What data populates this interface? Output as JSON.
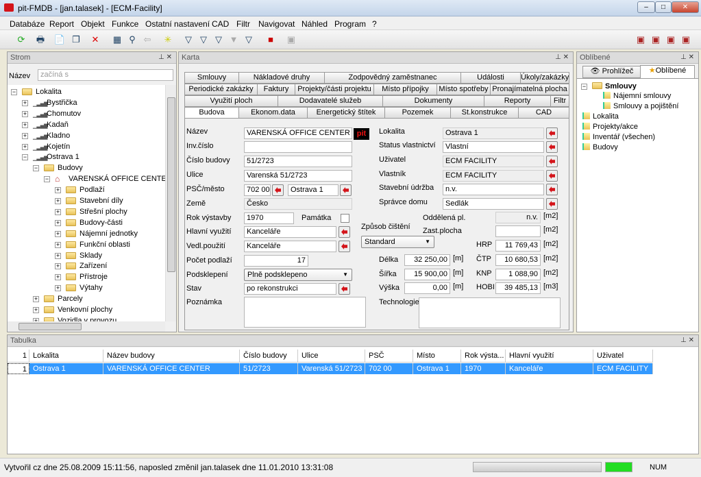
{
  "window": {
    "title": "pit-FMDB - [jan.talasek] - [ECM-Facility]",
    "minimize": "–",
    "maximize": "□",
    "close": "✕"
  },
  "menu": [
    "Databáze",
    "Report",
    "Objekt",
    "Funkce",
    "Ostatní nastavení",
    "CAD",
    "Filtr",
    "Navigovat",
    "Náhled",
    "Program",
    "?"
  ],
  "toolbar": [
    "refresh-icon",
    "print-icon",
    "new-icon",
    "copy-icon",
    "delete-icon",
    "tree-icon",
    "binoculars-icon",
    "back-arrow-icon",
    "sparkle-icon",
    "filter-lightning-icon",
    "filter-table-icon",
    "filter-icon",
    "filter-clear-icon",
    "filter-edit-icon",
    "pit-logo-icon",
    "save-icon"
  ],
  "toolbar_right": [
    "report-icon",
    "car-icon",
    "document-icon",
    "user-icon"
  ],
  "strom": {
    "title": "Strom",
    "search_label": "Název",
    "search_placeholder": "začíná s",
    "items": [
      {
        "label": "Lokalita",
        "level": 0,
        "icon": "folder",
        "exp": "−"
      },
      {
        "label": "Bystřička",
        "level": 1,
        "icon": "bars",
        "exp": "+"
      },
      {
        "label": "Chomutov",
        "level": 1,
        "icon": "bars",
        "exp": "+"
      },
      {
        "label": "Kadaň",
        "level": 1,
        "icon": "bars",
        "exp": "+"
      },
      {
        "label": "Kladno",
        "level": 1,
        "icon": "bars",
        "exp": "+"
      },
      {
        "label": "Kojetín",
        "level": 1,
        "icon": "bars",
        "exp": "+"
      },
      {
        "label": "Ostrava 1",
        "level": 1,
        "icon": "bars",
        "exp": "−"
      },
      {
        "label": "Budovy",
        "level": 2,
        "icon": "folder",
        "exp": "−"
      },
      {
        "label": "VARENSKÁ OFFICE CENTER",
        "level": 3,
        "icon": "house",
        "exp": "−"
      },
      {
        "label": "Podlaží",
        "level": 4,
        "icon": "folder",
        "exp": "+"
      },
      {
        "label": "Stavební díly",
        "level": 4,
        "icon": "folder",
        "exp": "+"
      },
      {
        "label": "Střešní plochy",
        "level": 4,
        "icon": "folder",
        "exp": "+"
      },
      {
        "label": "Budovy-části",
        "level": 4,
        "icon": "folder",
        "exp": "+"
      },
      {
        "label": "Nájemní jednotky",
        "level": 4,
        "icon": "folder",
        "exp": "+"
      },
      {
        "label": "Funkční oblasti",
        "level": 4,
        "icon": "folder",
        "exp": "+"
      },
      {
        "label": "Sklady",
        "level": 4,
        "icon": "folder",
        "exp": "+"
      },
      {
        "label": "Zařízení",
        "level": 4,
        "icon": "folder",
        "exp": "+"
      },
      {
        "label": "Přístroje",
        "level": 4,
        "icon": "folder",
        "exp": "+"
      },
      {
        "label": "Výtahy",
        "level": 4,
        "icon": "folder",
        "exp": "+"
      },
      {
        "label": "Parcely",
        "level": 2,
        "icon": "folder",
        "exp": "+"
      },
      {
        "label": "Venkovní plochy",
        "level": 2,
        "icon": "folder",
        "exp": "+"
      },
      {
        "label": "Vozidla v provozu",
        "level": 2,
        "icon": "folder",
        "exp": "+"
      }
    ]
  },
  "karta": {
    "title": "Karta",
    "tab_rows": [
      [
        "Smlouvy",
        "Nákladové druhy",
        "Zodpovědný zaměstnanec",
        "Události",
        "Úkoly/zakázky"
      ],
      [
        "Periodické zakázky",
        "Faktury",
        "Projekty/části projektu",
        "Místo přípojky",
        "Místo spotřeby",
        "Pronajímatelná plocha"
      ],
      [
        "Využití ploch",
        "Dodavatelé služeb",
        "Dokumenty",
        "Reporty",
        "Filtr"
      ],
      [
        "Budova",
        "Ekonom.data",
        "Energetický štítek",
        "Pozemek",
        "St.konstrukce",
        "CAD"
      ]
    ],
    "active_tab": "Budova",
    "form": {
      "nazev": {
        "label": "Název",
        "value": "VARENSKÁ OFFICE CENTER"
      },
      "inv_cislo": {
        "label": "Inv.číslo",
        "value": ""
      },
      "cislo_budovy": {
        "label": "Číslo budovy",
        "value": "51/2723"
      },
      "ulice": {
        "label": "Ulice",
        "value": "Varenská 51/2723"
      },
      "psc_mesto": {
        "label": "PSČ/město",
        "psc": "702 00",
        "mesto": "Ostrava 1"
      },
      "zeme": {
        "label": "Země",
        "value": "Česko"
      },
      "rok_vystavby": {
        "label": "Rok výstavby",
        "value": "1970"
      },
      "pamatka": {
        "label": "Památka",
        "checked": false
      },
      "hlavni_vyuziti": {
        "label": "Hlavní využití",
        "value": "Kanceláře"
      },
      "vedl_pouziti": {
        "label": "Vedl.použití",
        "value": "Kanceláře"
      },
      "pocet_podlazi": {
        "label": "Počet podlaží",
        "value": "17"
      },
      "podsklepeni": {
        "label": "Podsklepení",
        "value": "Plně podsklepeno"
      },
      "stav": {
        "label": "Stav",
        "value": "po rekonstrukci"
      },
      "poznamka": {
        "label": "Poznámka",
        "value": ""
      },
      "lokalita": {
        "label": "Lokalita",
        "value": "Ostrava 1"
      },
      "status": {
        "label": "Status vlastnictví",
        "value": "Vlastní"
      },
      "uzivatel": {
        "label": "Uživatel",
        "value": "ECM FACILITY"
      },
      "vlastnik": {
        "label": "Vlastník",
        "value": "ECM FACILITY"
      },
      "udrzba": {
        "label": "Stavební údržba",
        "value": "n.v."
      },
      "spravce": {
        "label": "Správce domu",
        "value": "Sedlák"
      },
      "oddelena": {
        "label": "Oddělená pl.",
        "value": "n.v.",
        "unit": "[m2]"
      },
      "zast_plocha": {
        "label": "Zast.plocha",
        "value": "",
        "unit": "[m2]"
      },
      "zpusob_cisteni": {
        "label": "Způsob čištění",
        "value": "Standard"
      },
      "hrp": {
        "label": "HRP",
        "value": "11 769,43",
        "unit": "[m2]"
      },
      "ctp": {
        "label": "ČTP",
        "value": "10 680,53",
        "unit": "[m2]"
      },
      "knp": {
        "label": "KNP",
        "value": "1 088,90",
        "unit": "[m2]"
      },
      "hobi": {
        "label": "HOBI",
        "value": "39 485,13",
        "unit": "[m3]"
      },
      "delka": {
        "label": "Délka",
        "value": "32 250,00",
        "unit": "[m]"
      },
      "sirka": {
        "label": "Šířka",
        "value": "15 900,00",
        "unit": "[m]"
      },
      "vyska": {
        "label": "Výška",
        "value": "0,00",
        "unit": "[m]"
      },
      "technologie": {
        "label": "Technologie",
        "value": ""
      },
      "logo": "pit"
    }
  },
  "oblibene": {
    "title": "Oblíbené",
    "tabs": [
      "Prohlížeč",
      "Oblíbené"
    ],
    "items": [
      {
        "label": "Smlouvy",
        "level": 0,
        "bold": true
      },
      {
        "label": "Nájemní smlouvy",
        "level": 1
      },
      {
        "label": "Smlouvy  a pojištění",
        "level": 1
      },
      {
        "label": "Lokalita",
        "level": 0
      },
      {
        "label": "Projekty/akce",
        "level": 0
      },
      {
        "label": "Inventář (všechen)",
        "level": 0
      },
      {
        "label": "Budovy",
        "level": 0
      }
    ]
  },
  "tabulka": {
    "title": "Tabulka",
    "columns": [
      "1",
      "Lokalita",
      "Název budovy",
      "Číslo budovy",
      "Ulice",
      "PSČ",
      "Místo",
      "Rok výsta...",
      "Hlavní využití",
      "Uživatel"
    ],
    "rows": [
      [
        "1",
        "Ostrava 1",
        "VARENSKÁ OFFICE CENTER",
        "51/2723",
        "Varenská 51/2723",
        "702 00",
        "Ostrava 1",
        "1970",
        "Kanceláře",
        "ECM FACILITY"
      ]
    ]
  },
  "status": {
    "text": "Vytvořil cz dne 25.08.2009 15:11:56, naposled změnil jan.talasek dne 11.01.2010 13:31:08",
    "num": "NUM"
  },
  "colors": {
    "selection": "#3399ff",
    "accent_red": "#d4141a",
    "progress": "#22dd22"
  }
}
